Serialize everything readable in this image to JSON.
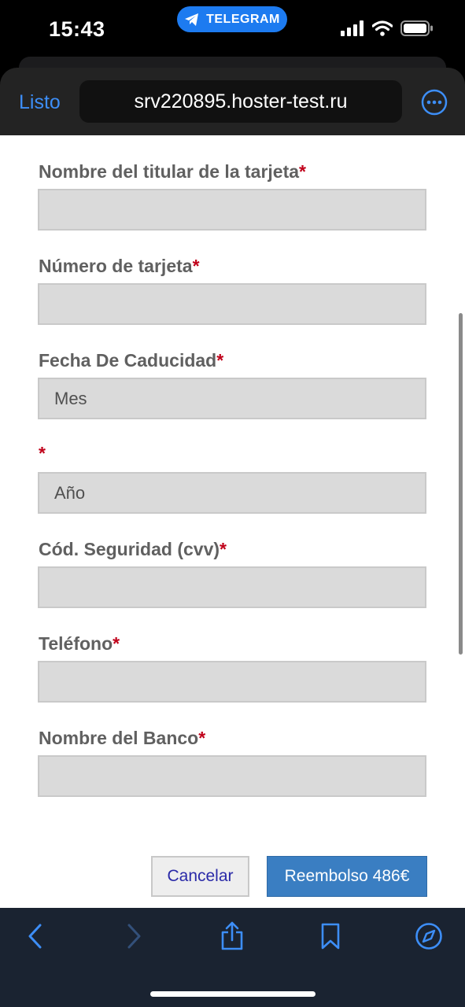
{
  "status_bar": {
    "time": "15:43",
    "pill_app": "TELEGRAM",
    "icons": [
      "signal-icon",
      "wifi-icon",
      "battery-icon"
    ]
  },
  "browser": {
    "done_label": "Listo",
    "url": "srv220895.hoster-test.ru",
    "more_icon": "ellipsis-circle-icon",
    "accent_color": "#3d8ef7"
  },
  "form": {
    "required_marker": "*",
    "fields": [
      {
        "label": "Nombre del titular de la tarjeta",
        "value": ""
      },
      {
        "label": "Número de tarjeta",
        "value": ""
      },
      {
        "label": "Fecha De Caducidad",
        "value": "Mes"
      },
      {
        "label": "",
        "value": "Año"
      },
      {
        "label": "Cód. Seguridad (cvv)",
        "value": ""
      },
      {
        "label": "Teléfono",
        "value": ""
      },
      {
        "label": "Nombre del Banco",
        "value": ""
      }
    ],
    "cancel_label": "Cancelar",
    "submit_label": "Reembolso 486€",
    "submit_color": "#3a7ec2",
    "required_color": "#c0001a"
  },
  "toolbar": {
    "icons": [
      "back-chevron-icon",
      "forward-chevron-icon",
      "share-icon",
      "bookmarks-icon",
      "compass-icon"
    ]
  }
}
